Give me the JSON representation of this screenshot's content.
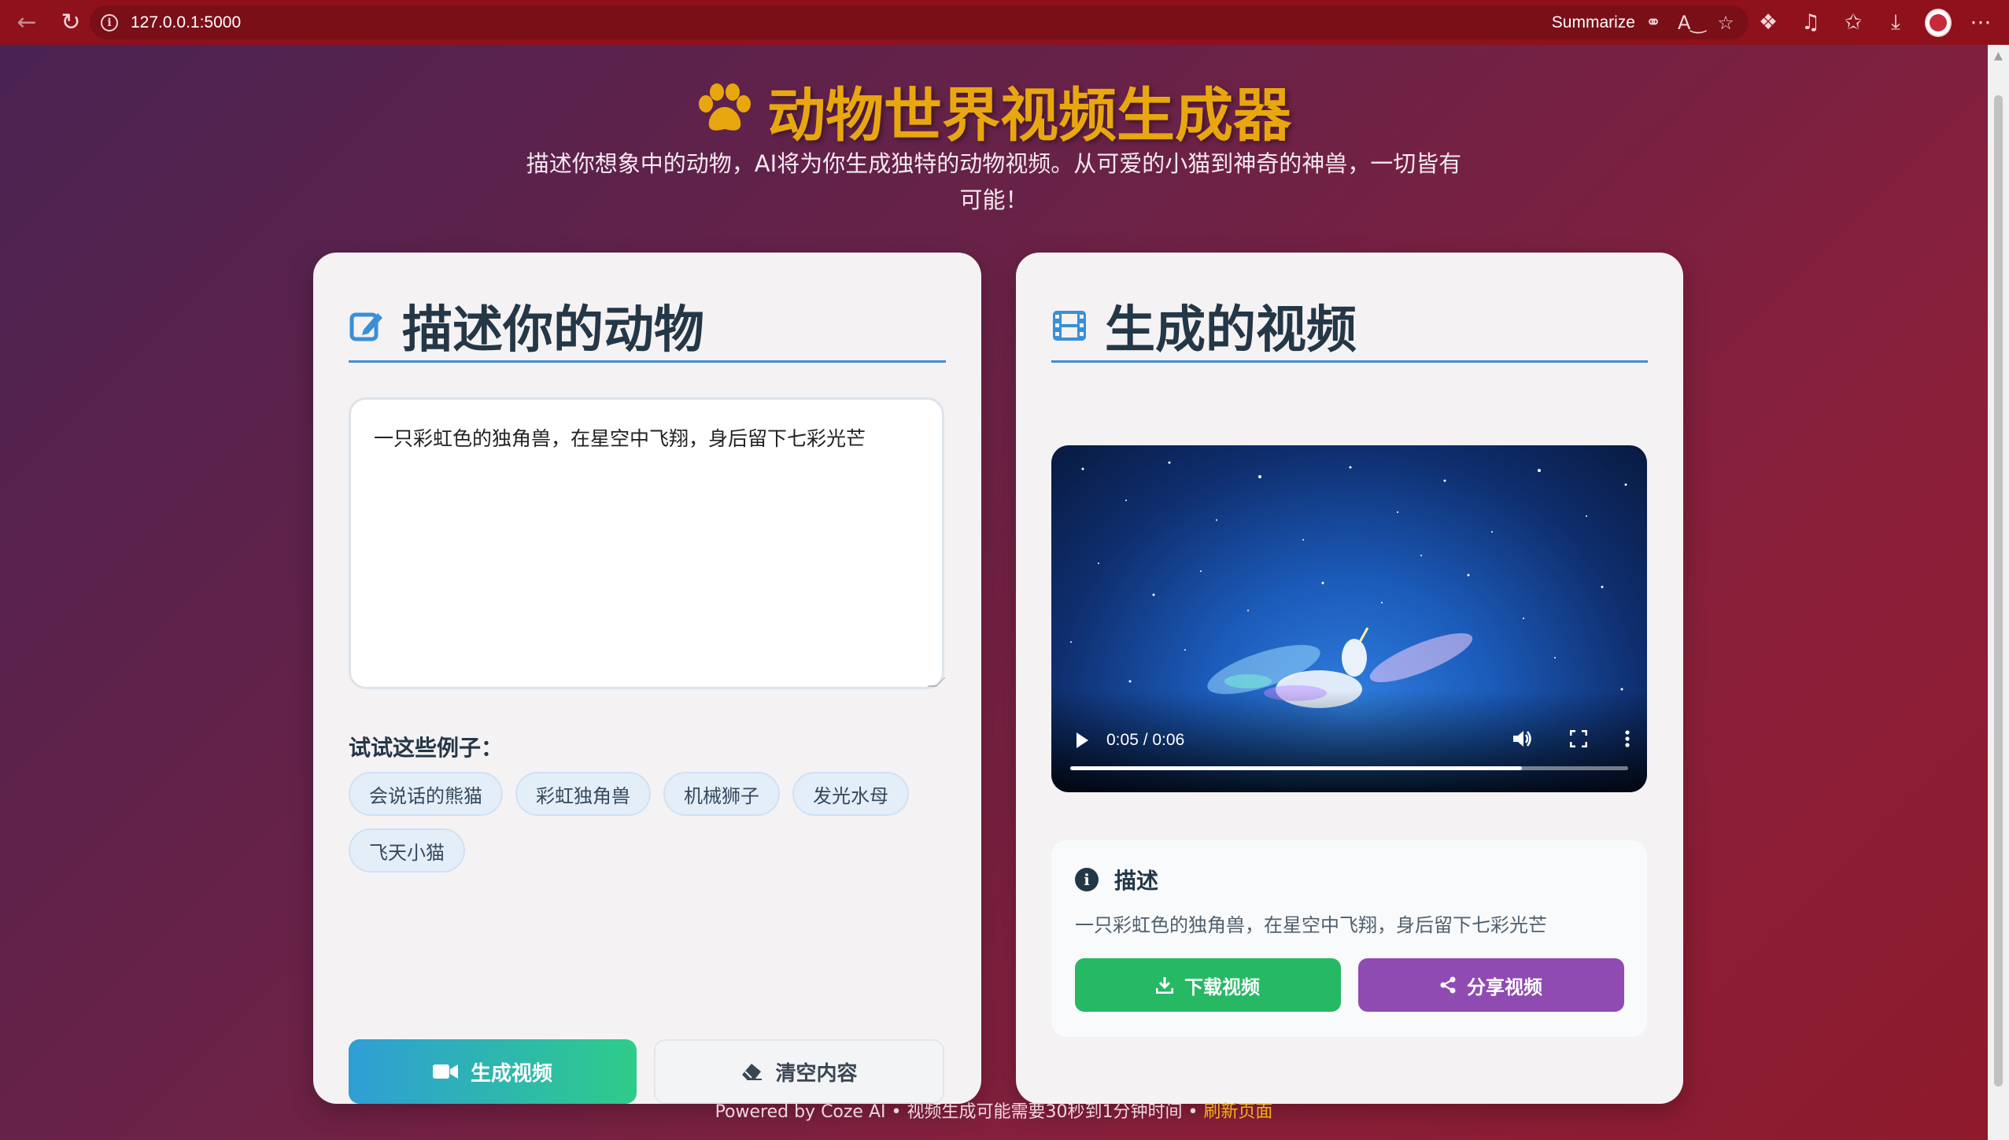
{
  "browser": {
    "url": "127.0.0.1:5000",
    "summarize_label": "Summarize"
  },
  "header": {
    "title": "动物世界视频生成器",
    "subtitle_line1": "描述你想象中的动物，AI将为你生成独特的动物视频。从可爱的小猫到神奇的神兽，一切皆有",
    "subtitle_line2": "可能！"
  },
  "left_card": {
    "heading": "描述你的动物",
    "prompt_value": "一只彩虹色的独角兽，在星空中飞翔，身后留下七彩光芒",
    "examples_label": "试试这些例子：",
    "examples": [
      "会说话的熊猫",
      "彩虹独角兽",
      "机械狮子",
      "发光水母",
      "飞天小猫"
    ],
    "generate_label": "生成视频",
    "clear_label": "清空内容"
  },
  "right_card": {
    "heading": "生成的视频",
    "video": {
      "time_display": "0:05 / 0:06",
      "progress": 0.81
    },
    "description_title": "描述",
    "description_text": "一只彩虹色的独角兽，在星空中飞翔，身后留下七彩光芒",
    "download_label": "下载视频",
    "share_label": "分享视频"
  },
  "footer": {
    "text": "Powered by Coze AI • 视频生成可能需要30秒到1分钟时间 • ",
    "refresh_link": "刷新页面"
  },
  "colors": {
    "title": "#e8a70f",
    "accent_blue": "#3a8fd6",
    "download_green": "#27b864",
    "share_purple": "#8f4bb2",
    "browser_frame": "#8e111c"
  }
}
